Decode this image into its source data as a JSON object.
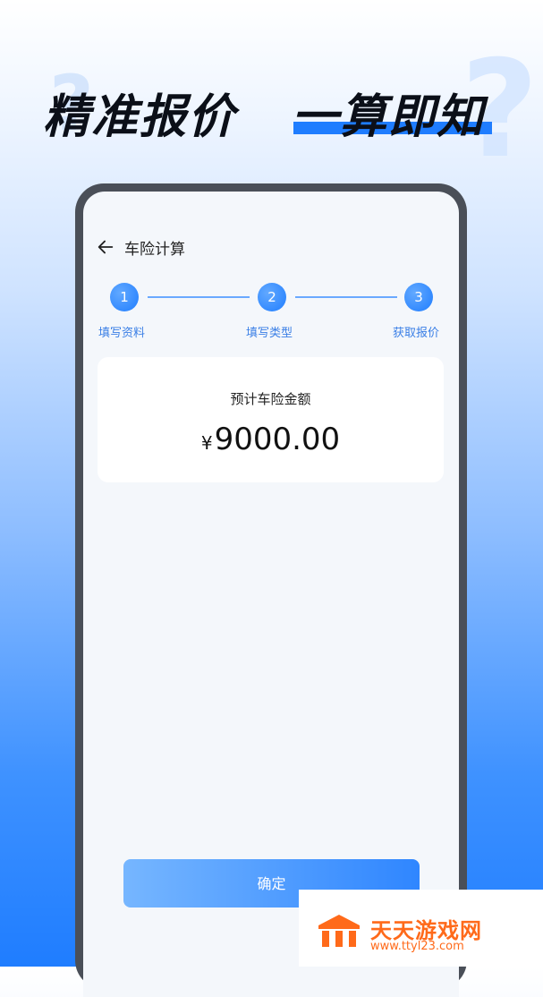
{
  "headline": {
    "left": "精准报价",
    "right": "一算即知"
  },
  "nav": {
    "title": "车险计算"
  },
  "steps": [
    {
      "number": "1",
      "label": "填写资料"
    },
    {
      "number": "2",
      "label": "填写类型"
    },
    {
      "number": "3",
      "label": "获取报价"
    }
  ],
  "card": {
    "title": "预计车险金额",
    "currency": "¥",
    "amount": "9000.00"
  },
  "confirm": {
    "label": "确定"
  },
  "watermark": {
    "title": "天天游戏网",
    "url": "www.ttyl23.com"
  },
  "colors": {
    "accent": "#1f7dff",
    "step": "#3a7fe6",
    "watermark": "#ff6a1a"
  }
}
